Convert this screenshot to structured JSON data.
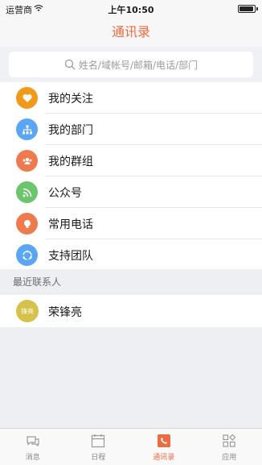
{
  "status_bar": {
    "carrier": "运营商",
    "time": "上午10:50"
  },
  "nav": {
    "title": "通讯录"
  },
  "search": {
    "placeholder": "姓名/域帐号/邮箱/电话/部门"
  },
  "menu_items": [
    {
      "label": "我的关注",
      "icon": "heart-icon",
      "color": "#f19a1a"
    },
    {
      "label": "我的部门",
      "icon": "org-icon",
      "color": "#5aa6f5"
    },
    {
      "label": "我的群组",
      "icon": "group-icon",
      "color": "#ef7a4e"
    },
    {
      "label": "公众号",
      "icon": "rss-icon",
      "color": "#6cc46c"
    },
    {
      "label": "常用电话",
      "icon": "phone-icon",
      "color": "#ef7a4e"
    },
    {
      "label": "支持团队",
      "icon": "support-icon",
      "color": "#5aa6f5"
    }
  ],
  "recent": {
    "header": "最近联系人",
    "contacts": [
      {
        "name": "荣锋亮",
        "avatar_text": "锋亮",
        "avatar_color": "#d6c24a"
      }
    ]
  },
  "tabs": [
    {
      "label": "消息",
      "icon": "chat-icon",
      "active": false
    },
    {
      "label": "日程",
      "icon": "calendar-icon",
      "active": false
    },
    {
      "label": "通讯录",
      "icon": "contacts-icon",
      "active": true
    },
    {
      "label": "应用",
      "icon": "apps-icon",
      "active": false
    }
  ],
  "colors": {
    "accent": "#ec6b3f"
  }
}
